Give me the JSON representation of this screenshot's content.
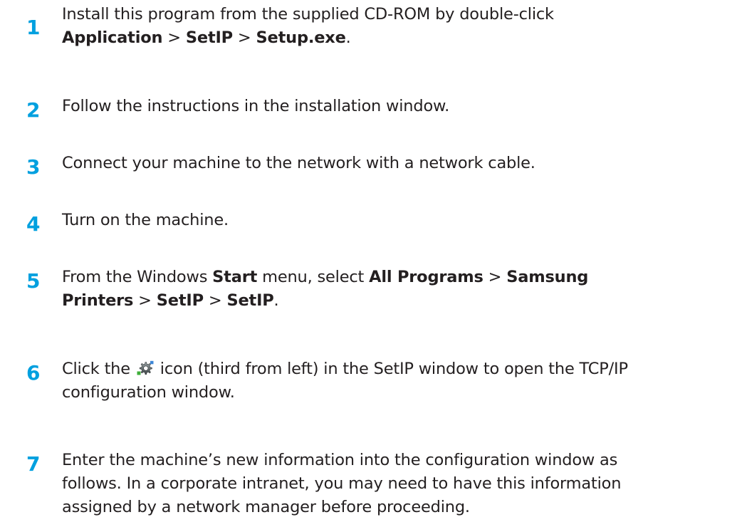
{
  "steps": [
    {
      "number": "1",
      "line1": {
        "a": "Install this program from the supplied CD-ROM by double-click"
      },
      "line2": {
        "b1": "Application",
        "sep1": " > ",
        "b2": "SetIP",
        "sep2": " > ",
        "b3": "Setup.exe",
        "end": "."
      }
    },
    {
      "number": "2",
      "text": "Follow the instructions in the installation window."
    },
    {
      "number": "3",
      "text": "Connect your machine to the network with a network cable."
    },
    {
      "number": "4",
      "text": "Turn on the machine."
    },
    {
      "number": "5",
      "line1": {
        "a": "From the Windows ",
        "b1": "Start",
        "c": " menu, select ",
        "b2": "All Programs",
        "d": " > ",
        "b3": "Samsung"
      },
      "line2": {
        "b1": "Printers",
        "sep1": " > ",
        "b2": "SetIP",
        "sep2": " > ",
        "b3": "SetIP",
        "end": "."
      }
    },
    {
      "number": "6",
      "icon": "tcpip-config-gear-icon",
      "line1": {
        "a": "Click the ",
        "b": " icon (third from left) in the SetIP window to open the TCP/IP"
      },
      "line2": {
        "a": "configuration window."
      }
    },
    {
      "number": "7",
      "line1": "Enter the machine’s new information into the configuration window as",
      "line2": "follows. In a corporate intranet, you may need to have this information",
      "line3": "assigned by a network manager before proceeding."
    }
  ],
  "colors": {
    "step_number": "#00a0df",
    "body_text": "#231f20"
  }
}
